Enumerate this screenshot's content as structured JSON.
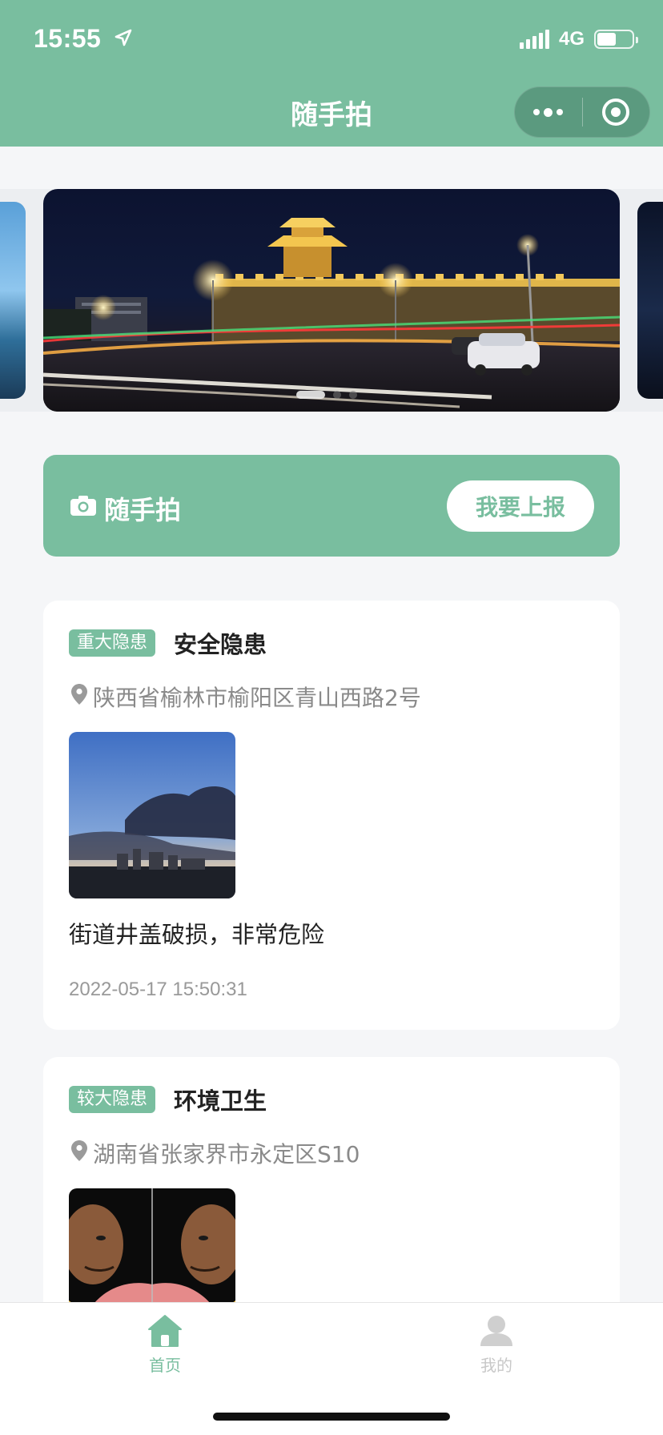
{
  "status_bar": {
    "time": "15:55",
    "network": "4G",
    "battery_level": 0.55
  },
  "nav": {
    "title": "随手拍",
    "capsule_more_icon": "more-dots-icon",
    "capsule_close_icon": "target-ring-icon"
  },
  "banner": {
    "slide_count": 3,
    "active_index": 0
  },
  "report": {
    "title": "随手拍",
    "button_label": "我要上报",
    "icon": "camera-icon"
  },
  "reports": [
    {
      "tag": "重大隐患",
      "title": "安全隐患",
      "address": "陕西省榆林市榆阳区青山西路2号",
      "description": "街道井盖破损，非常危险",
      "time": "2022-05-17 15:50:31"
    },
    {
      "tag": "较大隐患",
      "title": "环境卫生",
      "address": "湖南省张家界市永定区S10"
    }
  ],
  "tabbar": {
    "home_label": "首页",
    "mine_label": "我的"
  },
  "colors": {
    "brand": "#79be9f",
    "muted": "#8a8a8a",
    "inactive": "#c8c8c8"
  }
}
